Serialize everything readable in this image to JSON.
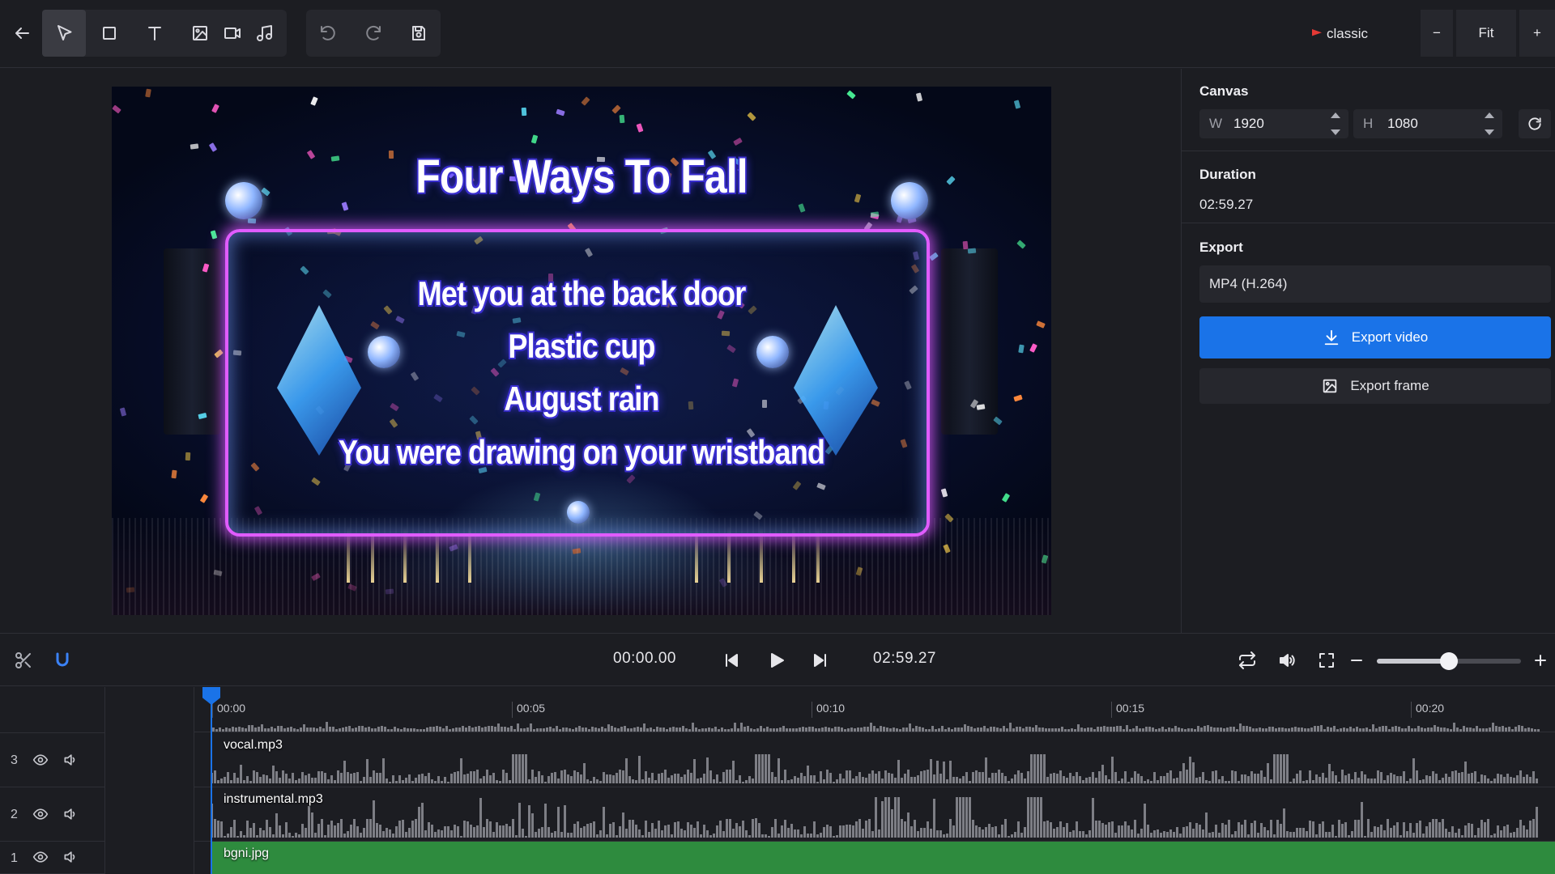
{
  "toolbar": {
    "icons": [
      "back-arrow-icon",
      "select-cursor-icon",
      "rectangle-icon",
      "text-icon",
      "image-icon",
      "video-icon",
      "music-icon",
      "undo-icon",
      "redo-icon",
      "save-icon"
    ],
    "theme_label": "classic",
    "zoom_out_label": "−",
    "zoom_fit_label": "Fit",
    "zoom_in_label": "+",
    "accent_color": "#1a73e8"
  },
  "preview": {
    "title": "Four Ways To Fall",
    "lyrics": [
      "Met you at the back door",
      "Plastic cup",
      "August rain",
      "You were drawing on your wristband"
    ]
  },
  "panel": {
    "canvas": {
      "title": "Canvas",
      "width_key": "W",
      "width_value": "1920",
      "height_key": "H",
      "height_value": "1080"
    },
    "duration": {
      "title": "Duration",
      "value": "02:59.27"
    },
    "export": {
      "title": "Export",
      "format": "MP4 (H.264)",
      "export_video_label": "Export video",
      "export_frame_label": "Export frame"
    }
  },
  "transport": {
    "current_time": "00:00.00",
    "total_time": "02:59.27",
    "volume_level": 0.5
  },
  "timeline": {
    "ruler_ticks": [
      "00:00",
      "00:05",
      "00:10",
      "00:15",
      "00:20"
    ],
    "tracks": [
      {
        "number": "3",
        "clip": "vocal.mp3"
      },
      {
        "number": "2",
        "clip": "instrumental.mp3"
      },
      {
        "number": "1",
        "clip": "bgni.jpg"
      }
    ],
    "image_clip_color": "#2e8b3e"
  }
}
